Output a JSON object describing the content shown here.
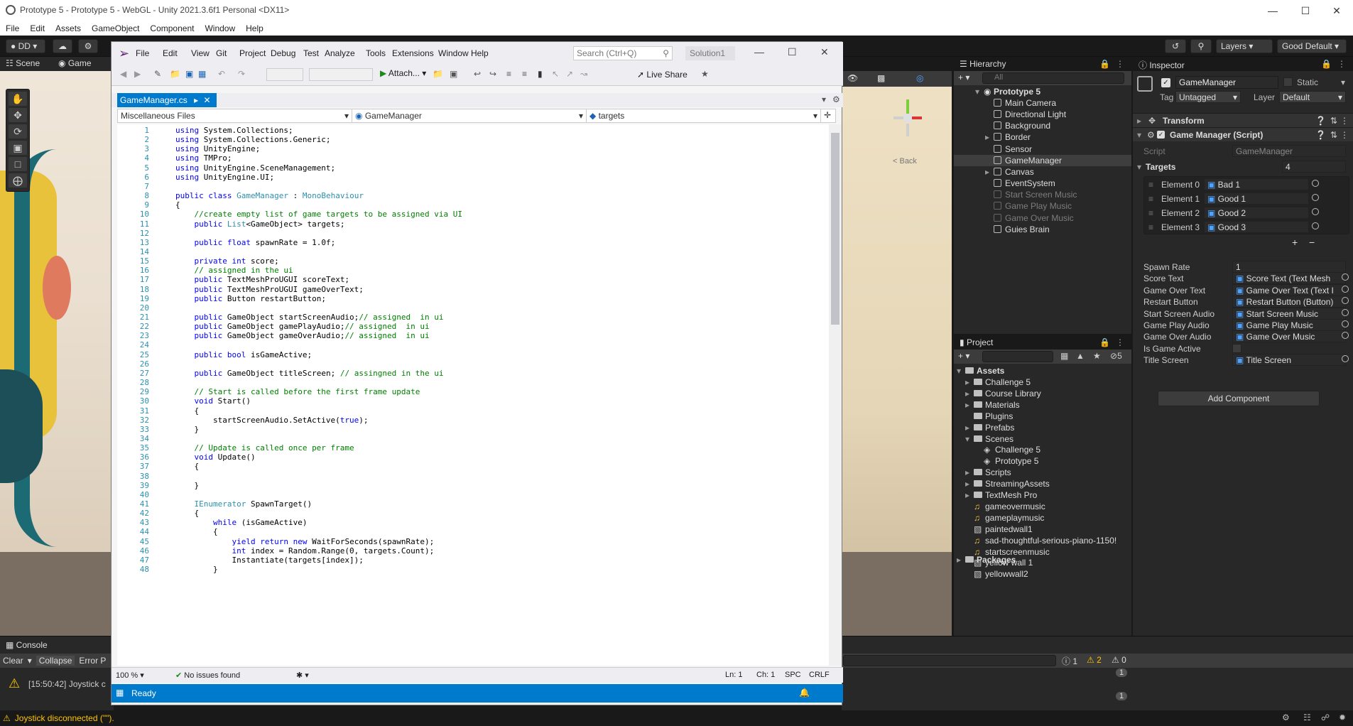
{
  "unity": {
    "title": "Prototype 5 - Prototype 5 - WebGL - Unity 2021.3.6f1 Personal <DX11>",
    "menu": [
      "File",
      "Edit",
      "Assets",
      "GameObject",
      "Component",
      "Window",
      "Help"
    ],
    "account": "DD",
    "layers": "Layers",
    "layout": "Good Default",
    "scene_tab": "Scene",
    "game_tab": "Game",
    "back_label": "< Back",
    "console_tab": "Console",
    "console_clear": "Clear",
    "console_collapse": "Collapse",
    "console_error": "Error P",
    "console_entry": "[15:50:42] Joystick c",
    "status_msg": "Joystick disconnected (\"\").",
    "console_counts": {
      "info": "1",
      "warn": "2",
      "err": "0"
    },
    "console_row_counts": [
      "1",
      "1"
    ]
  },
  "vs": {
    "menu": [
      "File",
      "Edit",
      "View",
      "Git",
      "Project",
      "Debug",
      "Test",
      "Analyze",
      "Tools",
      "Extensions",
      "Window",
      "Help"
    ],
    "search_placeholder": "Search (Ctrl+Q)",
    "solution": "Solution1",
    "live_share": "Live Share",
    "attach": "Attach...",
    "tab_name": "GameManager.cs",
    "nav_files": "Miscellaneous Files",
    "nav_class": "GameManager",
    "nav_member": "targets",
    "zoom": "100 %",
    "issues": "No issues found",
    "ln": "Ln: 1",
    "ch": "Ch: 1",
    "spc": "SPC",
    "crlf": "CRLF",
    "status": "Ready",
    "code_lines": [
      "using System.Collections;",
      "using System.Collections.Generic;",
      "using UnityEngine;",
      "using TMPro;",
      "using UnityEngine.SceneManagement;",
      "using UnityEngine.UI;",
      "",
      "public class GameManager : MonoBehaviour",
      "{",
      "    //create empty list of game targets to be assigned via UI",
      "    public List<GameObject> targets;",
      "",
      "    public float spawnRate = 1.0f;",
      "",
      "    private int score;",
      "    // assigned in the ui",
      "    public TextMeshProUGUI scoreText;",
      "    public TextMeshProUGUI gameOverText;",
      "    public Button restartButton;",
      "",
      "    public GameObject startScreenAudio;// assigned  in ui",
      "    public GameObject gamePlayAudio;// assigned  in ui",
      "    public GameObject gameOverAudio;// assigned  in ui",
      "",
      "    public bool isGameActive;",
      "",
      "    public GameObject titleScreen; // assingned in the ui",
      "",
      "    // Start is called before the first frame update",
      "    void Start()",
      "    {",
      "        startScreenAudio.SetActive(true);",
      "    }",
      "",
      "    // Update is called once per frame",
      "    void Update()",
      "    {",
      "",
      "    }",
      "",
      "    IEnumerator SpawnTarget()",
      "    {",
      "        while (isGameActive)",
      "        {",
      "            yield return new WaitForSeconds(spawnRate);",
      "            int index = Random.Range(0, targets.Count);",
      "            Instantiate(targets[index]);",
      "        }"
    ]
  },
  "hierarchy": {
    "title": "Hierarchy",
    "search_placeholder": "All",
    "root": "Prototype 5",
    "items": [
      {
        "label": "Main Camera",
        "dim": false,
        "expand": false
      },
      {
        "label": "Directional Light",
        "dim": false,
        "expand": false
      },
      {
        "label": "Background",
        "dim": false,
        "expand": false
      },
      {
        "label": "Border",
        "dim": false,
        "expand": true
      },
      {
        "label": "Sensor",
        "dim": false,
        "expand": false
      },
      {
        "label": "GameManager",
        "dim": false,
        "expand": false,
        "selected": true
      },
      {
        "label": "Canvas",
        "dim": false,
        "expand": true
      },
      {
        "label": "EventSystem",
        "dim": false,
        "expand": false
      },
      {
        "label": "Start Screen Music",
        "dim": true,
        "expand": false
      },
      {
        "label": "Game Play Music",
        "dim": true,
        "expand": false
      },
      {
        "label": "Game Over Music",
        "dim": true,
        "expand": false
      },
      {
        "label": "Guies Brain",
        "dim": false,
        "expand": false
      }
    ]
  },
  "project": {
    "title": "Project",
    "hidden_count": "5",
    "assets_label": "Assets",
    "items": [
      {
        "label": "Challenge 5",
        "indent": 1,
        "kind": "folder"
      },
      {
        "label": "Course Library",
        "indent": 1,
        "kind": "folder"
      },
      {
        "label": "Materials",
        "indent": 1,
        "kind": "folder"
      },
      {
        "label": "Plugins",
        "indent": 1,
        "kind": "folder"
      },
      {
        "label": "Prefabs",
        "indent": 1,
        "kind": "folder"
      },
      {
        "label": "Scenes",
        "indent": 1,
        "kind": "folder"
      },
      {
        "label": "Challenge 5",
        "indent": 2,
        "kind": "scene"
      },
      {
        "label": "Prototype 5",
        "indent": 2,
        "kind": "scene"
      },
      {
        "label": "Scripts",
        "indent": 1,
        "kind": "folder"
      },
      {
        "label": "StreamingAssets",
        "indent": 1,
        "kind": "folder"
      },
      {
        "label": "TextMesh Pro",
        "indent": 1,
        "kind": "folder"
      },
      {
        "label": "gameovermusic",
        "indent": 1,
        "kind": "audio"
      },
      {
        "label": "gameplaymusic",
        "indent": 1,
        "kind": "audio"
      },
      {
        "label": "paintedwall1",
        "indent": 1,
        "kind": "image"
      },
      {
        "label": "sad-thoughtful-serious-piano-1150!",
        "indent": 1,
        "kind": "audio"
      },
      {
        "label": "startscreenmusic",
        "indent": 1,
        "kind": "audio"
      },
      {
        "label": "yellow wall 1",
        "indent": 1,
        "kind": "image"
      },
      {
        "label": "yellowwall2",
        "indent": 1,
        "kind": "image"
      }
    ],
    "packages_label": "Packages"
  },
  "inspector": {
    "title": "Inspector",
    "object_name": "GameManager",
    "static_label": "Static",
    "tag_label": "Tag",
    "tag_value": "Untagged",
    "layer_label": "Layer",
    "layer_value": "Default",
    "transform": "Transform",
    "component": "Game Manager (Script)",
    "script_label": "Script",
    "script_value": "GameManager",
    "targets_label": "Targets",
    "targets_count": "4",
    "targets": [
      {
        "label": "Element 0",
        "value": "Bad 1"
      },
      {
        "label": "Element 1",
        "value": "Good 1"
      },
      {
        "label": "Element 2",
        "value": "Good 2"
      },
      {
        "label": "Element 3",
        "value": "Good 3"
      }
    ],
    "fields": [
      {
        "label": "Spawn Rate",
        "value": "1",
        "kind": "number"
      },
      {
        "label": "Score Text",
        "value": "Score Text (Text Mesh",
        "kind": "obj"
      },
      {
        "label": "Game Over Text",
        "value": "Game Over Text (Text I",
        "kind": "obj"
      },
      {
        "label": "Restart Button",
        "value": "Restart Button (Button)",
        "kind": "obj"
      },
      {
        "label": "Start Screen Audio",
        "value": "Start Screen Music",
        "kind": "obj"
      },
      {
        "label": "Game Play Audio",
        "value": "Game Play Music",
        "kind": "obj"
      },
      {
        "label": "Game Over Audio",
        "value": "Game Over Music",
        "kind": "obj"
      },
      {
        "label": "Is Game Active",
        "value": "",
        "kind": "bool"
      },
      {
        "label": "Title Screen",
        "value": "Title Screen",
        "kind": "obj"
      }
    ],
    "add_component": "Add Component"
  }
}
